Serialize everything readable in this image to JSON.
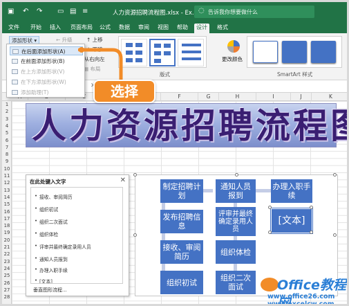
{
  "titlebar": {
    "title": "人力资源招聘流程图.xlsx - Ex...",
    "search_placeholder": "告诉我你想要做什么",
    "qa_icons": [
      "save-icon",
      "undo-icon",
      "redo-icon",
      "folder-icon",
      "print-icon",
      "format-icon"
    ]
  },
  "tabs": [
    "文件",
    "开始",
    "插入",
    "页面布局",
    "公式",
    "数据",
    "审阅",
    "视图",
    "帮助",
    "设计",
    "格式"
  ],
  "active_tab": "设计",
  "ribbon": {
    "add_shape_label": "添加形状",
    "promote_label": "升级",
    "move_up_label": "上移",
    "demote_label": "降级",
    "move_down_label": "下移",
    "right_to_left_label": "从右向左",
    "layout_label": "布局",
    "layouts_group": "版式",
    "change_color_label": "更改颜色",
    "styles_group": "SmartArt 样式"
  },
  "dropdown": {
    "items": [
      {
        "label": "在后面添加形状(A)",
        "enabled": true
      },
      {
        "label": "在前面添加形状(B)",
        "enabled": true
      },
      {
        "label": "在上方添加形状(V)",
        "enabled": false
      },
      {
        "label": "在下方添加形状(W)",
        "enabled": false
      },
      {
        "label": "添加助理(T)",
        "enabled": false
      }
    ]
  },
  "callout": {
    "text": "选择",
    "color": "#f28c28"
  },
  "columns": [
    "A",
    "B",
    "C",
    "D",
    "E",
    "F",
    "G",
    "H",
    "I",
    "J",
    "K"
  ],
  "rows": [
    "1",
    "2",
    "3",
    "4",
    "5",
    "6",
    "7",
    "8",
    "9",
    "10",
    "11",
    "12",
    "13",
    "14",
    "15",
    "16",
    "17",
    "18",
    "19",
    "20",
    "21",
    "22",
    "23",
    "24",
    "25",
    "26",
    "27",
    "28"
  ],
  "banner": {
    "text": "人力资源招聘流程图"
  },
  "textpane": {
    "title": "在此处键入文字",
    "items": [
      "接收、审阅简历",
      "组织初试",
      "组织二次面试",
      "组织体检",
      "评审并最终确定录用人员",
      "通知人员报到",
      "办理入职手续",
      "[文本]"
    ],
    "footer_link": "垂直图形流程..."
  },
  "diagram": {
    "nodes": [
      "制定招聘计划",
      "通知人员报到",
      "办理入职手续",
      "发布招聘信息",
      "评审并最终确定录用人员",
      "[文本]",
      "接收、审阅简历",
      "组织体检",
      "组织初试",
      "组织二次面试"
    ],
    "node_color": "#4472c4",
    "connector_color": "#c4cde6"
  },
  "watermark": {
    "title": "Office教程网",
    "url": "www.office26.com",
    "url2": "www.excelcw.com"
  },
  "colors": {
    "accent": "#217346",
    "smartart": "#4472c4",
    "callout": "#f28c28"
  }
}
